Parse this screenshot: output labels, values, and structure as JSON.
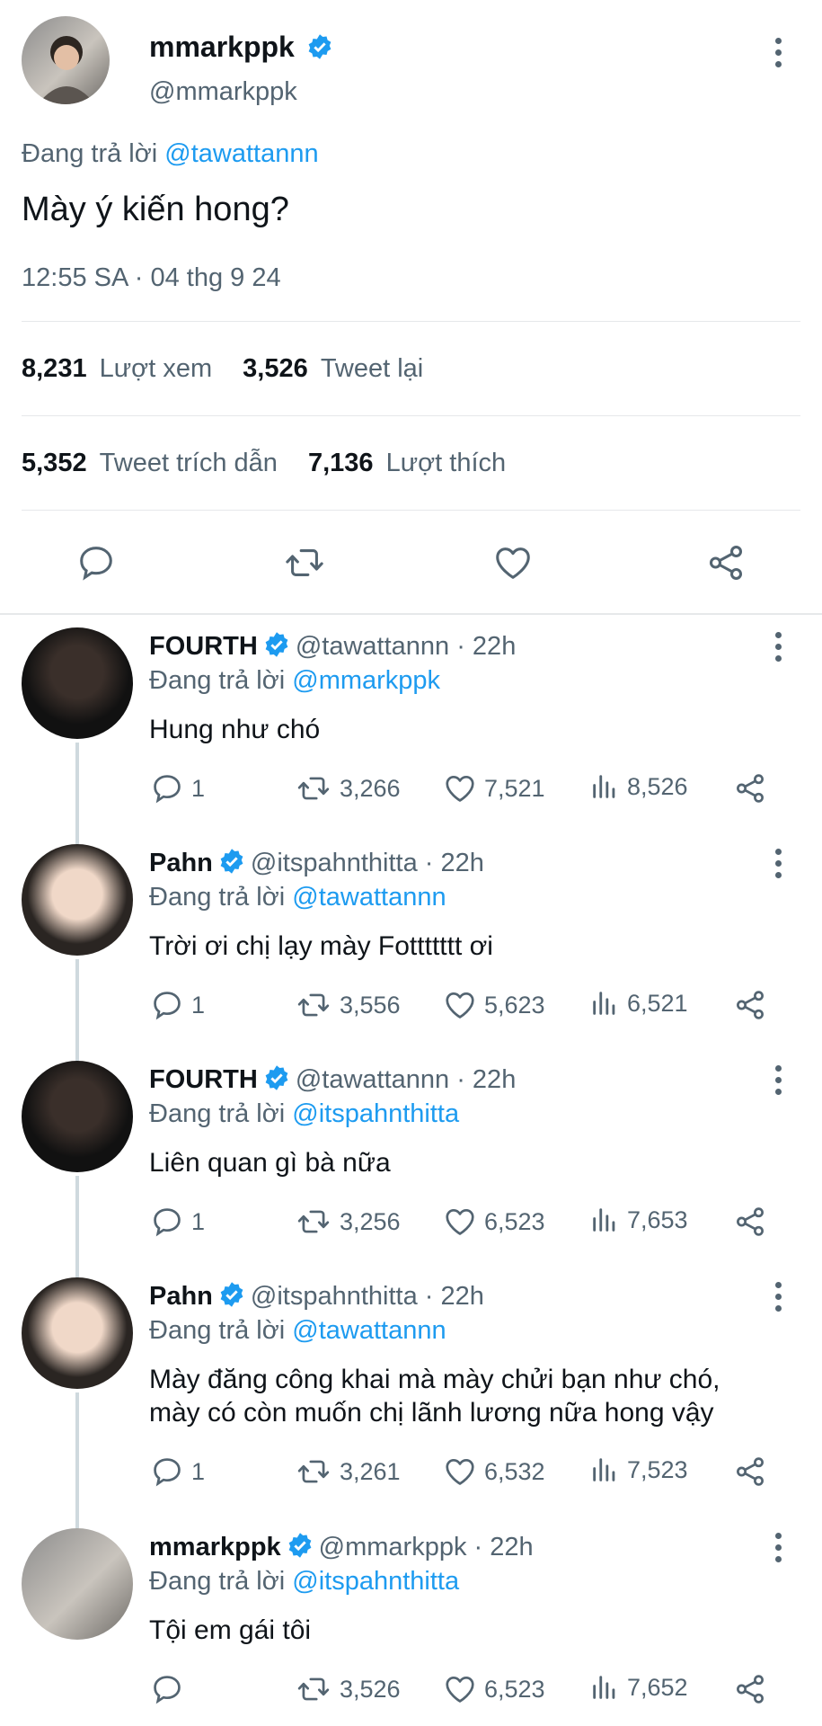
{
  "main_tweet": {
    "display_name": "mmarkppk",
    "handle": "@mmarkppk",
    "reply_prefix": "Đang trả lời",
    "reply_to": "@tawattannn",
    "text": "Mày ý kiến hong?",
    "timestamp": "12:55 SA · 04 thg 9 24",
    "stats": {
      "views_count": "8,231",
      "views_label": "Lượt xem",
      "retweets_count": "3,526",
      "retweets_label": "Tweet lại",
      "quotes_count": "5,352",
      "quotes_label": "Tweet trích dẫn",
      "likes_count": "7,136",
      "likes_label": "Lượt thích"
    }
  },
  "replies": [
    {
      "display_name": "FOURTH",
      "handle": "@tawattannn",
      "time": "· 22h",
      "reply_prefix": "Đang trả lời",
      "reply_to": "@mmarkppk",
      "text": [
        "Hung như chó"
      ],
      "replies": "1",
      "retweets": "3,266",
      "likes": "7,521",
      "views": "8,526"
    },
    {
      "display_name": "Pahn",
      "handle": "@itspahnthitta",
      "time": "· 22h",
      "reply_prefix": "Đang trả lời",
      "reply_to": "@tawattannn",
      "text": [
        "Trời ơi chị lạy mày Fottttttt ơi"
      ],
      "replies": "1",
      "retweets": "3,556",
      "likes": "5,623",
      "views": "6,521"
    },
    {
      "display_name": "FOURTH",
      "handle": "@tawattannn",
      "time": "· 22h",
      "reply_prefix": "Đang trả lời",
      "reply_to": "@itspahnthitta",
      "text": [
        "Liên quan gì bà nữa"
      ],
      "replies": "1",
      "retweets": "3,256",
      "likes": "6,523",
      "views": "7,653"
    },
    {
      "display_name": "Pahn",
      "handle": "@itspahnthitta",
      "time": "· 22h",
      "reply_prefix": "Đang trả lời",
      "reply_to": "@tawattannn",
      "text": [
        "Mày đăng công khai mà mày chửi bạn như chó,",
        "mày có còn muốn chị lãnh lương nữa hong vậy"
      ],
      "replies": "1",
      "retweets": "3,261",
      "likes": "6,532",
      "views": "7,523"
    },
    {
      "display_name": "mmarkppk",
      "handle": "@mmarkppk",
      "time": "· 22h",
      "reply_prefix": "Đang trả lời",
      "reply_to": "@itspahnthitta",
      "text": [
        "Tội em gái tôi"
      ],
      "replies": "",
      "retweets": "3,526",
      "likes": "6,523",
      "views": "7,652"
    }
  ],
  "icons": {
    "verified": "verified-badge-icon",
    "more": "more-options-icon",
    "reply": "reply-icon",
    "retweet": "retweet-icon",
    "like": "heart-icon",
    "views": "views-chart-icon",
    "share": "share-icon"
  },
  "colors": {
    "accent": "#1d9bf0",
    "muted": "#536471",
    "text": "#0f1419"
  }
}
